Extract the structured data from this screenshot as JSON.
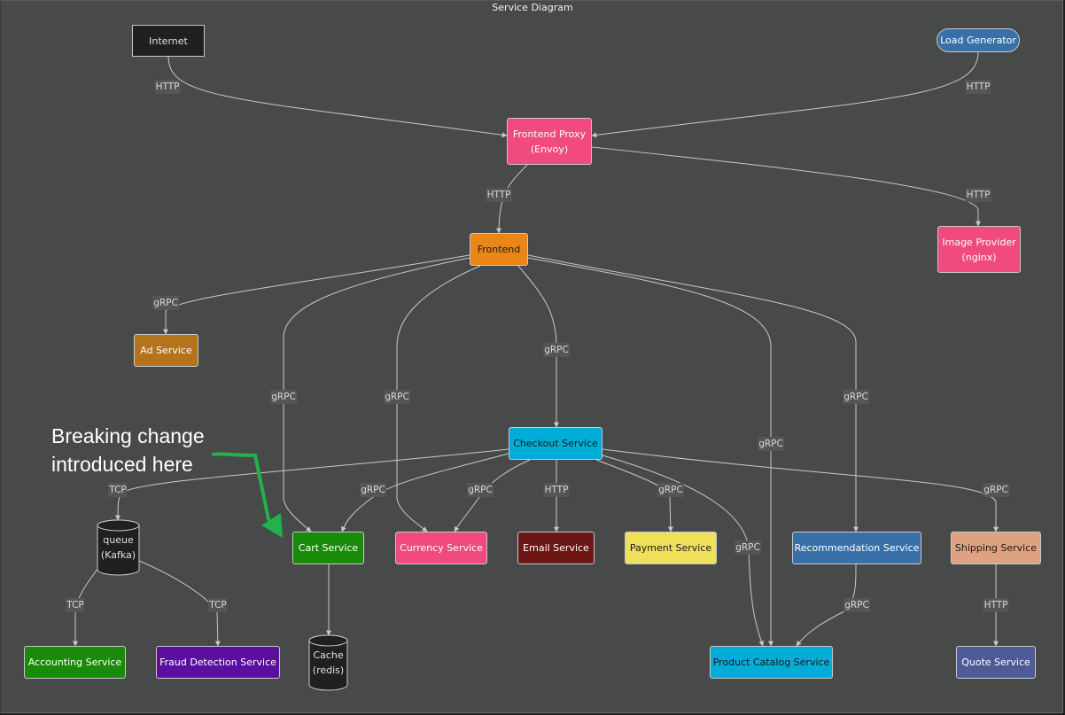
{
  "title": "Service Diagram",
  "annotation": {
    "text": "Breaking change\nintroduced here",
    "arrow_color": "#22b14c",
    "points_to": "cart"
  },
  "colors": {
    "background": "#484a49",
    "edge": "#c8c8c8",
    "label_bg": "#555555"
  },
  "nodes": [
    {
      "id": "internet",
      "label": "Internet",
      "shape": "square",
      "fill": "#1f2020",
      "text": "#e0e0e0"
    },
    {
      "id": "loadgen",
      "label": "Load Generator",
      "shape": "pill",
      "fill": "#3a70a8",
      "text": "#ffffff"
    },
    {
      "id": "proxy",
      "label": "Frontend Proxy\n(Envoy)",
      "shape": "rect",
      "fill": "#f04a7e",
      "text": "#ffffff"
    },
    {
      "id": "imageprov",
      "label": "Image Provider\n(nginx)",
      "shape": "rect",
      "fill": "#f04a7e",
      "text": "#ffffff"
    },
    {
      "id": "frontend",
      "label": "Frontend",
      "shape": "rect",
      "fill": "#ea8517",
      "text": "#1a1a1a"
    },
    {
      "id": "ad",
      "label": "Ad Service",
      "shape": "rect",
      "fill": "#b3741c",
      "text": "#ffffff"
    },
    {
      "id": "checkout",
      "label": "Checkout Service",
      "shape": "rect",
      "fill": "#00add7",
      "text": "#1a1a1a"
    },
    {
      "id": "kafka",
      "label": "queue\n(Kafka)",
      "shape": "cylinder",
      "fill": "#1f2020",
      "text": "#e0e0e0"
    },
    {
      "id": "cart",
      "label": "Cart Service",
      "shape": "rect",
      "fill": "#1a8a0a",
      "text": "#ffffff"
    },
    {
      "id": "currency",
      "label": "Currency Service",
      "shape": "rect",
      "fill": "#f04a7e",
      "text": "#ffffff"
    },
    {
      "id": "email",
      "label": "Email Service",
      "shape": "rect",
      "fill": "#6c1616",
      "text": "#ffffff"
    },
    {
      "id": "payment",
      "label": "Payment Service",
      "shape": "rect",
      "fill": "#efe05a",
      "text": "#1a1a1a"
    },
    {
      "id": "recommendation",
      "label": "Recommendation Service",
      "shape": "rect",
      "fill": "#3a70a8",
      "text": "#ffffff"
    },
    {
      "id": "shipping",
      "label": "Shipping Service",
      "shape": "rect",
      "fill": "#dea283",
      "text": "#1a1a1a"
    },
    {
      "id": "accounting",
      "label": "Accounting Service",
      "shape": "rect",
      "fill": "#1a8a0a",
      "text": "#ffffff"
    },
    {
      "id": "fraud",
      "label": "Fraud Detection Service",
      "shape": "rect",
      "fill": "#5a0fa0",
      "text": "#ffffff"
    },
    {
      "id": "redis",
      "label": "Cache\n(redis)",
      "shape": "cylinder",
      "fill": "#1f2020",
      "text": "#e0e0e0"
    },
    {
      "id": "catalog",
      "label": "Product Catalog Service",
      "shape": "rect",
      "fill": "#00add7",
      "text": "#1a1a1a"
    },
    {
      "id": "quote",
      "label": "Quote Service",
      "shape": "rect",
      "fill": "#4f5b96",
      "text": "#ffffff"
    }
  ],
  "edges": [
    {
      "from": "internet",
      "to": "proxy",
      "label": "HTTP"
    },
    {
      "from": "loadgen",
      "to": "proxy",
      "label": "HTTP"
    },
    {
      "from": "proxy",
      "to": "frontend",
      "label": "HTTP"
    },
    {
      "from": "proxy",
      "to": "imageprov",
      "label": "HTTP"
    },
    {
      "from": "frontend",
      "to": "ad",
      "label": "gRPC"
    },
    {
      "from": "frontend",
      "to": "cart",
      "label": "gRPC"
    },
    {
      "from": "frontend",
      "to": "currency",
      "label": "gRPC"
    },
    {
      "from": "frontend",
      "to": "checkout",
      "label": "gRPC"
    },
    {
      "from": "frontend",
      "to": "catalog",
      "label": "gRPC"
    },
    {
      "from": "frontend",
      "to": "recommendation",
      "label": "gRPC"
    },
    {
      "from": "checkout",
      "to": "kafka",
      "label": "TCP"
    },
    {
      "from": "checkout",
      "to": "cart",
      "label": "gRPC"
    },
    {
      "from": "checkout",
      "to": "currency",
      "label": "gRPC"
    },
    {
      "from": "checkout",
      "to": "email",
      "label": "HTTP"
    },
    {
      "from": "checkout",
      "to": "payment",
      "label": "gRPC"
    },
    {
      "from": "checkout",
      "to": "catalog",
      "label": "gRPC"
    },
    {
      "from": "checkout",
      "to": "shipping",
      "label": "gRPC"
    },
    {
      "from": "kafka",
      "to": "accounting",
      "label": "TCP"
    },
    {
      "from": "kafka",
      "to": "fraud",
      "label": "TCP"
    },
    {
      "from": "cart",
      "to": "redis",
      "label": ""
    },
    {
      "from": "recommendation",
      "to": "catalog",
      "label": "gRPC"
    },
    {
      "from": "shipping",
      "to": "quote",
      "label": "HTTP"
    }
  ]
}
